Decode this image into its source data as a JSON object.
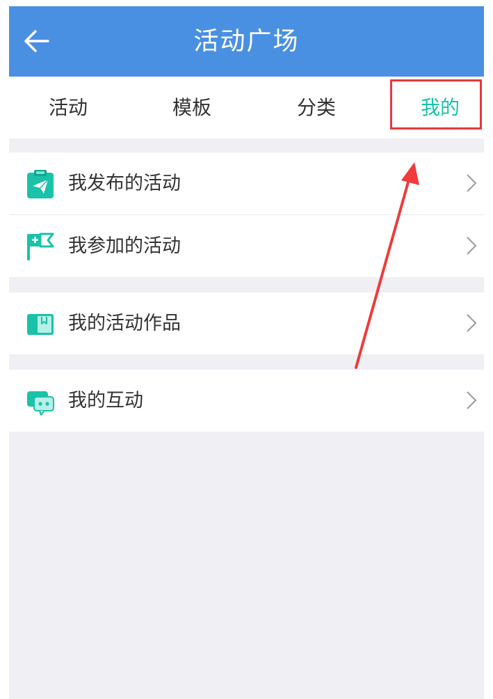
{
  "header": {
    "title": "活动广场",
    "back_icon": "arrow-left-icon"
  },
  "tabs": [
    {
      "label": "活动",
      "active": false
    },
    {
      "label": "模板",
      "active": false
    },
    {
      "label": "分类",
      "active": false
    },
    {
      "label": "我的",
      "active": true
    }
  ],
  "menu": {
    "items": [
      {
        "label": "我发布的活动",
        "icon": "clipboard-send-icon"
      },
      {
        "label": "我参加的活动",
        "icon": "flag-icon"
      },
      {
        "label": "我的活动作品",
        "icon": "book-icon"
      },
      {
        "label": "我的互动",
        "icon": "chat-icon"
      }
    ]
  },
  "colors": {
    "header_bg": "#4a90e2",
    "accent": "#19c2a8",
    "highlight": "#e8383d",
    "page_bg": "#efeff4"
  }
}
